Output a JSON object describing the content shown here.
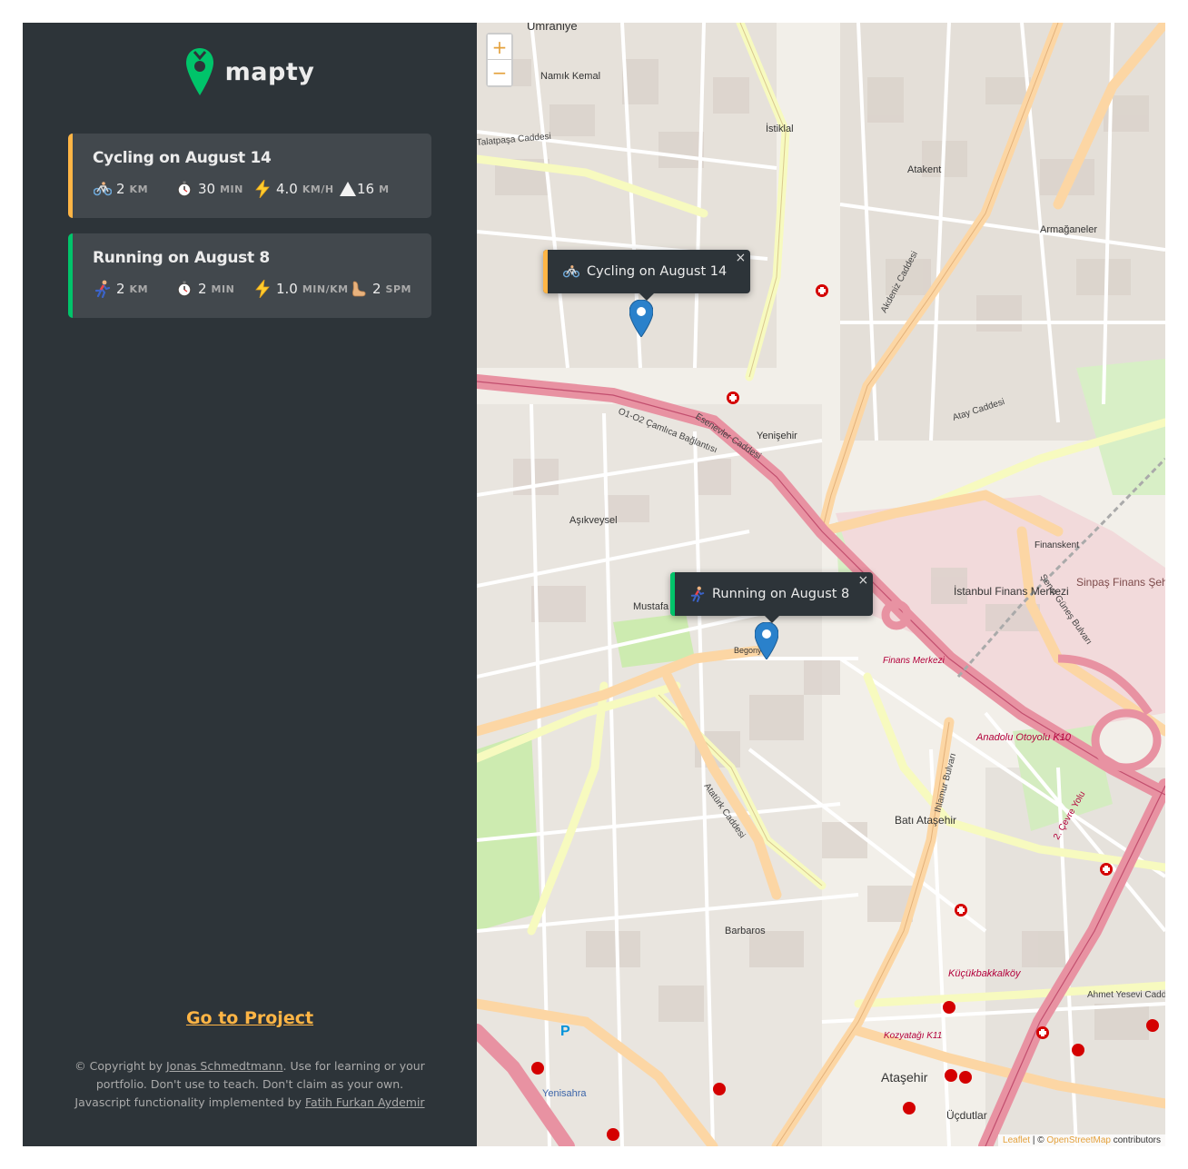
{
  "sidebar": {
    "logo_text": "mapty",
    "workouts": [
      {
        "type": "cycling",
        "title": "Cycling on August 14",
        "distance": "2",
        "distance_unit": "km",
        "duration": "30",
        "duration_unit": "min",
        "speed": "4.0",
        "speed_unit": "km/h",
        "elevation": "16",
        "elevation_unit": "m"
      },
      {
        "type": "running",
        "title": "Running on August 8",
        "distance": "2",
        "distance_unit": "km",
        "duration": "2",
        "duration_unit": "min",
        "pace": "1.0",
        "pace_unit": "min/km",
        "cadence": "2",
        "cadence_unit": "spm"
      }
    ],
    "footer": {
      "link_label": "Go to Project",
      "copyright_prefix": "© Copyright by",
      "author": "Jonas Schmedtmann",
      "copyright_mid": ". Use for learning or your portfolio. Don't use to teach. Don't claim as your own. Javascript functionality implemented by",
      "implementer": "Fatih Furkan Aydemir"
    }
  },
  "map": {
    "zoom_in": "+",
    "zoom_out": "−",
    "popups": [
      {
        "type": "cycling",
        "label": "Cycling on August 14",
        "close": "×"
      },
      {
        "type": "running",
        "label": "Running on August 8",
        "close": "×"
      }
    ],
    "labels": {
      "umraniye": "Ümraniye",
      "istiklal": "İstiklal",
      "atakent": "Atakent",
      "armaganevler": "Armağaneler",
      "yenisehir": "Yenişehir",
      "asikveysel": "Aşıkveysel",
      "mustafa": "Mustafa",
      "finans_merkezi": "İstanbul Finans Merkezi",
      "finanskent": "Finanskent",
      "sinpas": "Sinpaş Finans Şehir",
      "bati_atasehir": "Batı Ataşehir",
      "barbaros": "Barbaros",
      "yenisahra": "Yenisahra",
      "kucukbakkalkoy": "Küçükbakkalköy",
      "atasehir": "Ataşehir",
      "ucdutlar": "Üçdutlar",
      "namik_kemal": "Namık Kemal",
      "talatpasa": "Talatpaşa Caddesi",
      "esenevler": "Esenevler Caddesi",
      "camlica": "O1-O2 Çamlıca Bağlantısı",
      "anadolu_otoyolu": "Anadolu Otoyolu K10",
      "cevre_yolu": "2. Çevre Yolu",
      "ataturk": "Atatürk Caddesi",
      "ihlamur": "Ihlamur Bulvarı",
      "atay": "Atay Caddesi",
      "akdeniz": "Akdeniz Caddesi",
      "senol": "Şenol Güneş Bulvarı",
      "ahmet_yesevi": "Ahmet Yesevi Cadd",
      "finans_merkezi_stop": "Finans Merkezi",
      "kozyatagi": "Kozyatağı K11",
      "begonya": "Begonya"
    },
    "attribution": {
      "leaflet": "Leaflet",
      "sep": " | © ",
      "osm": "OpenStreetMap",
      "suffix": " contributors"
    }
  },
  "colors": {
    "sidebar_bg": "#2d3439",
    "card_bg": "#42484d",
    "brand_yellow": "#ffb545",
    "brand_green": "#00c46a",
    "text": "#ececec",
    "map_bg": "#f2efe9",
    "motorway": "#e892a2",
    "primary_road": "#fcd6a4",
    "secondary_road": "#f7fabf",
    "marker_blue": "#2a81cb"
  },
  "icons": {
    "cycling": "bicycle-icon",
    "duration": "stopwatch-icon",
    "speed": "lightning-icon",
    "elevation": "mountain-icon",
    "running": "runner-icon",
    "cadence": "foot-icon"
  }
}
